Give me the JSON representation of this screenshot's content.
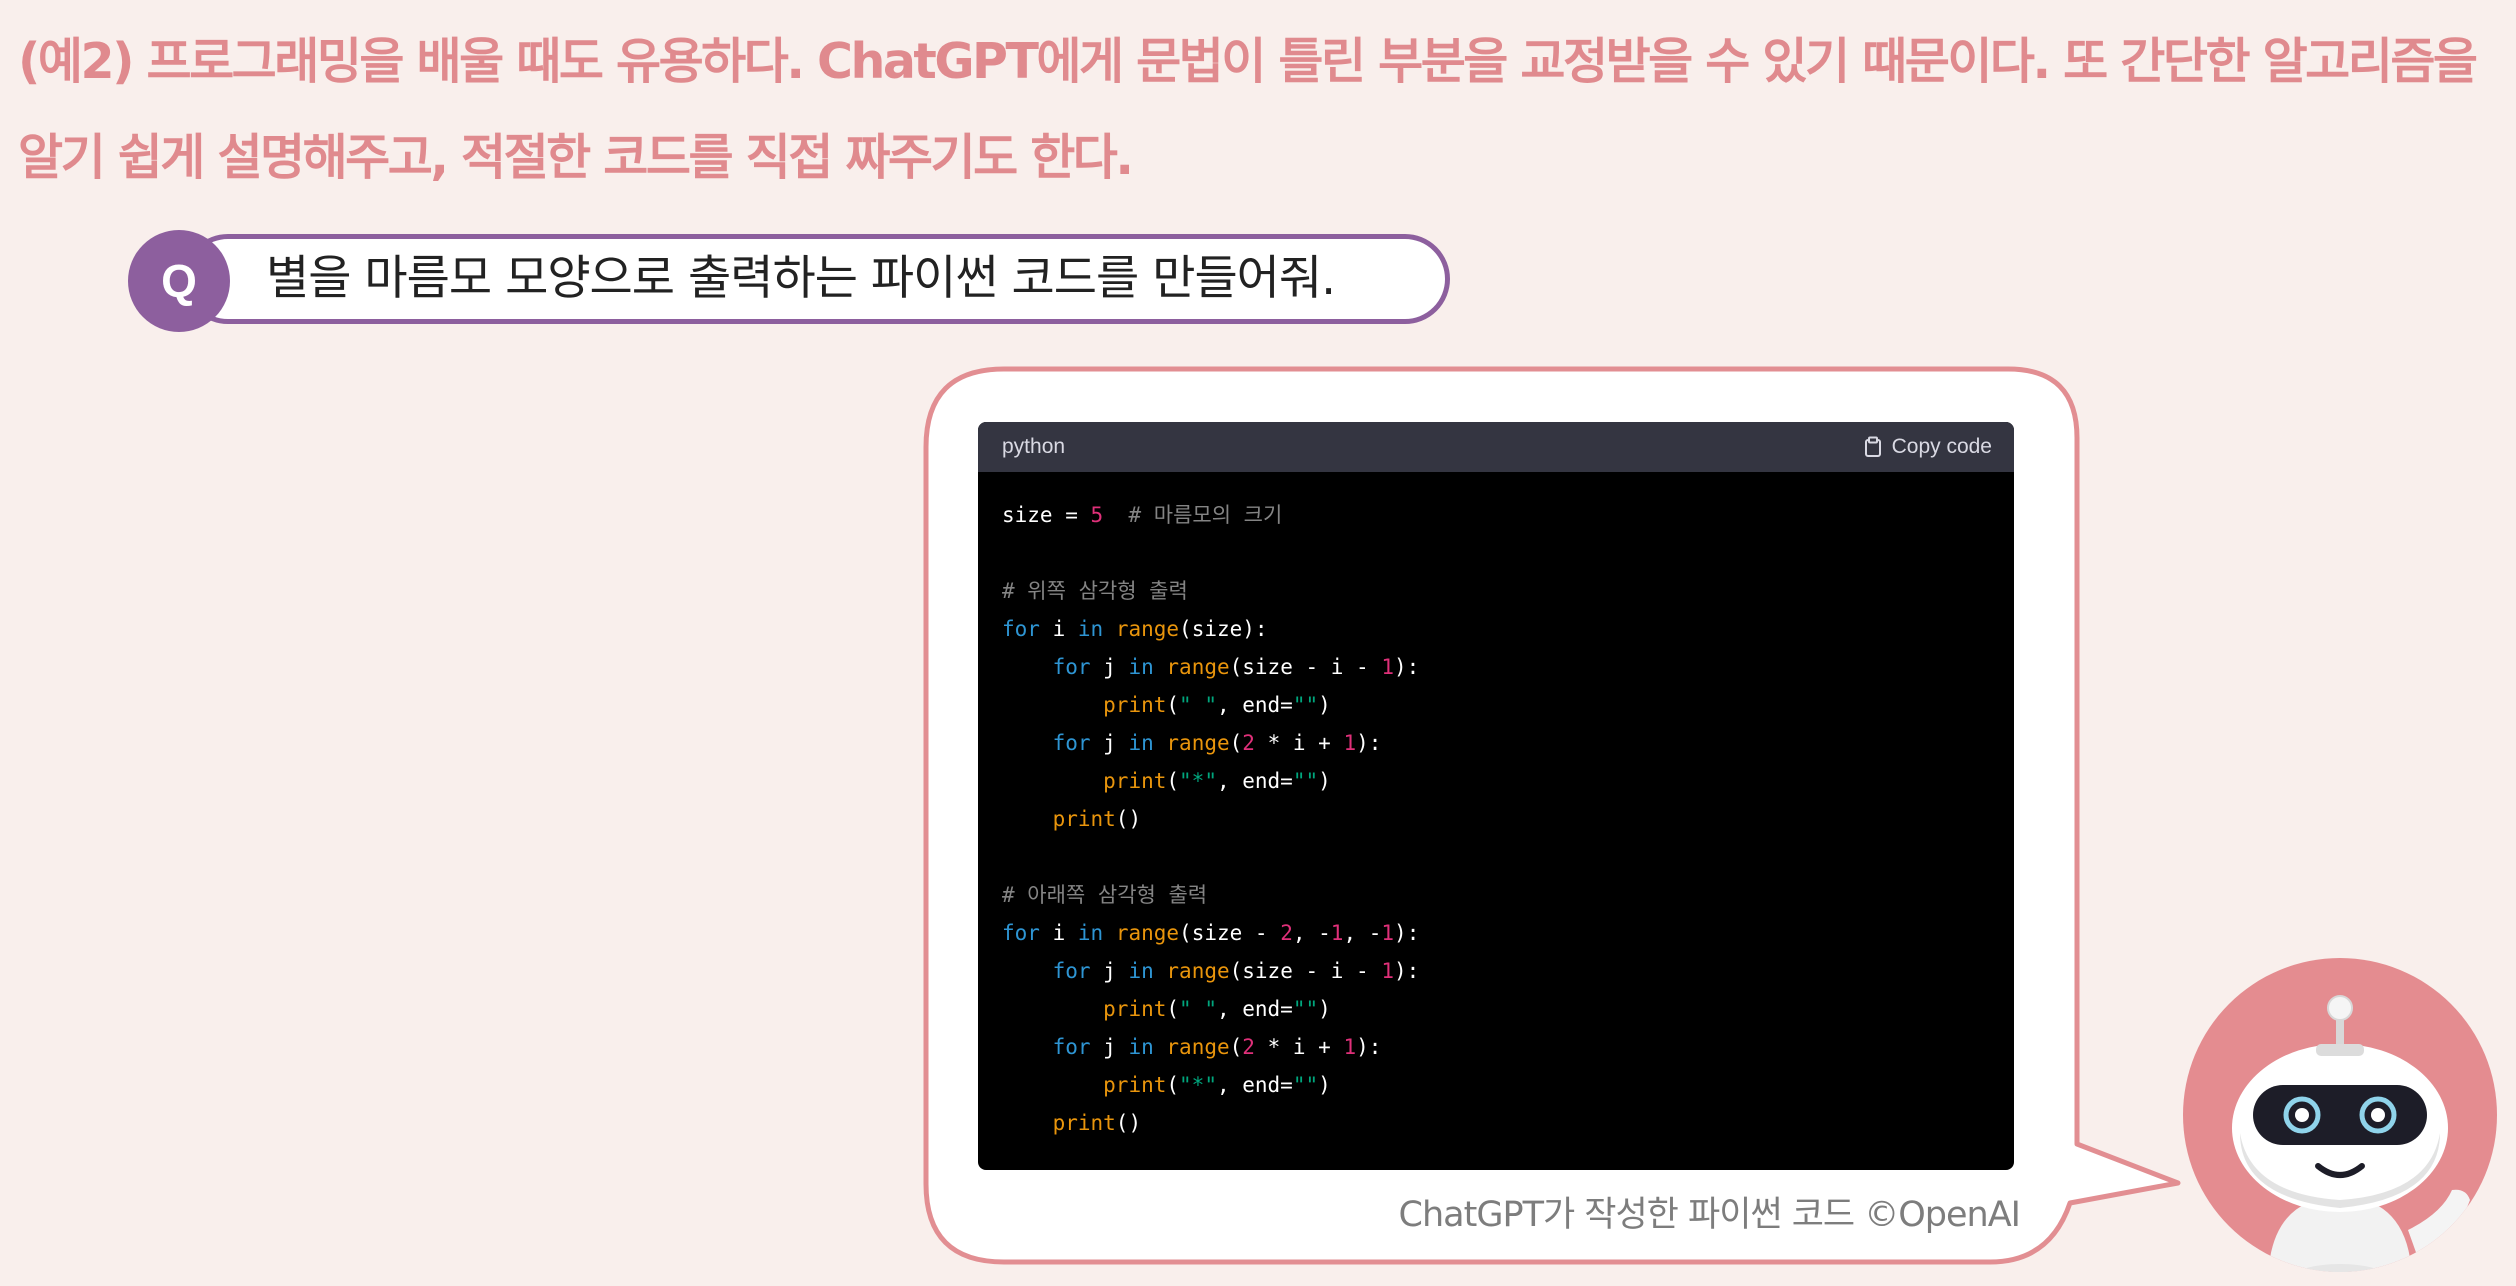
{
  "intro": {
    "text": "(예2) 프로그래밍을 배울 때도 유용하다. ChatGPT에게 문법이 틀린 부분을 교정받을 수 있기 때문이다. 또 간단한 알고리즘을 알기 쉽게 설명해주고, 적절한 코드를 직접 짜주기도 한다."
  },
  "question": {
    "badge": "Q",
    "text": "별을 마름모 모양으로 출력하는 파이썬 코드를 만들어줘."
  },
  "code_window": {
    "language": "python",
    "copy_label": "Copy code",
    "lines": [
      "size = 5  # 마름모의 크기",
      "",
      "# 위쪽 삼각형 출력",
      "for i in range(size):",
      "    for j in range(size - i - 1):",
      "        print(\" \", end=\"\")",
      "    for j in range(2 * i + 1):",
      "        print(\"*\", end=\"\")",
      "    print()",
      "",
      "# 아래쪽 삼각형 출력",
      "for i in range(size - 2, -1, -1):",
      "    for j in range(size - i - 1):",
      "        print(\" \", end=\"\")",
      "    for j in range(2 * i + 1):",
      "        print(\"*\", end=\"\")",
      "    print()"
    ]
  },
  "caption": "ChatGPT가 작성한 파이썬 코드 ©OpenAI",
  "colors": {
    "background": "#f9efec",
    "intro_text": "#e08a8e",
    "question_accent": "#8d5f9e",
    "bubble_border": "#e28e92",
    "code_bg": "#000000",
    "code_header": "#343541",
    "robot_circle": "#e48c90"
  },
  "icons": {
    "copy": "clipboard-icon",
    "robot": "robot-mascot"
  }
}
